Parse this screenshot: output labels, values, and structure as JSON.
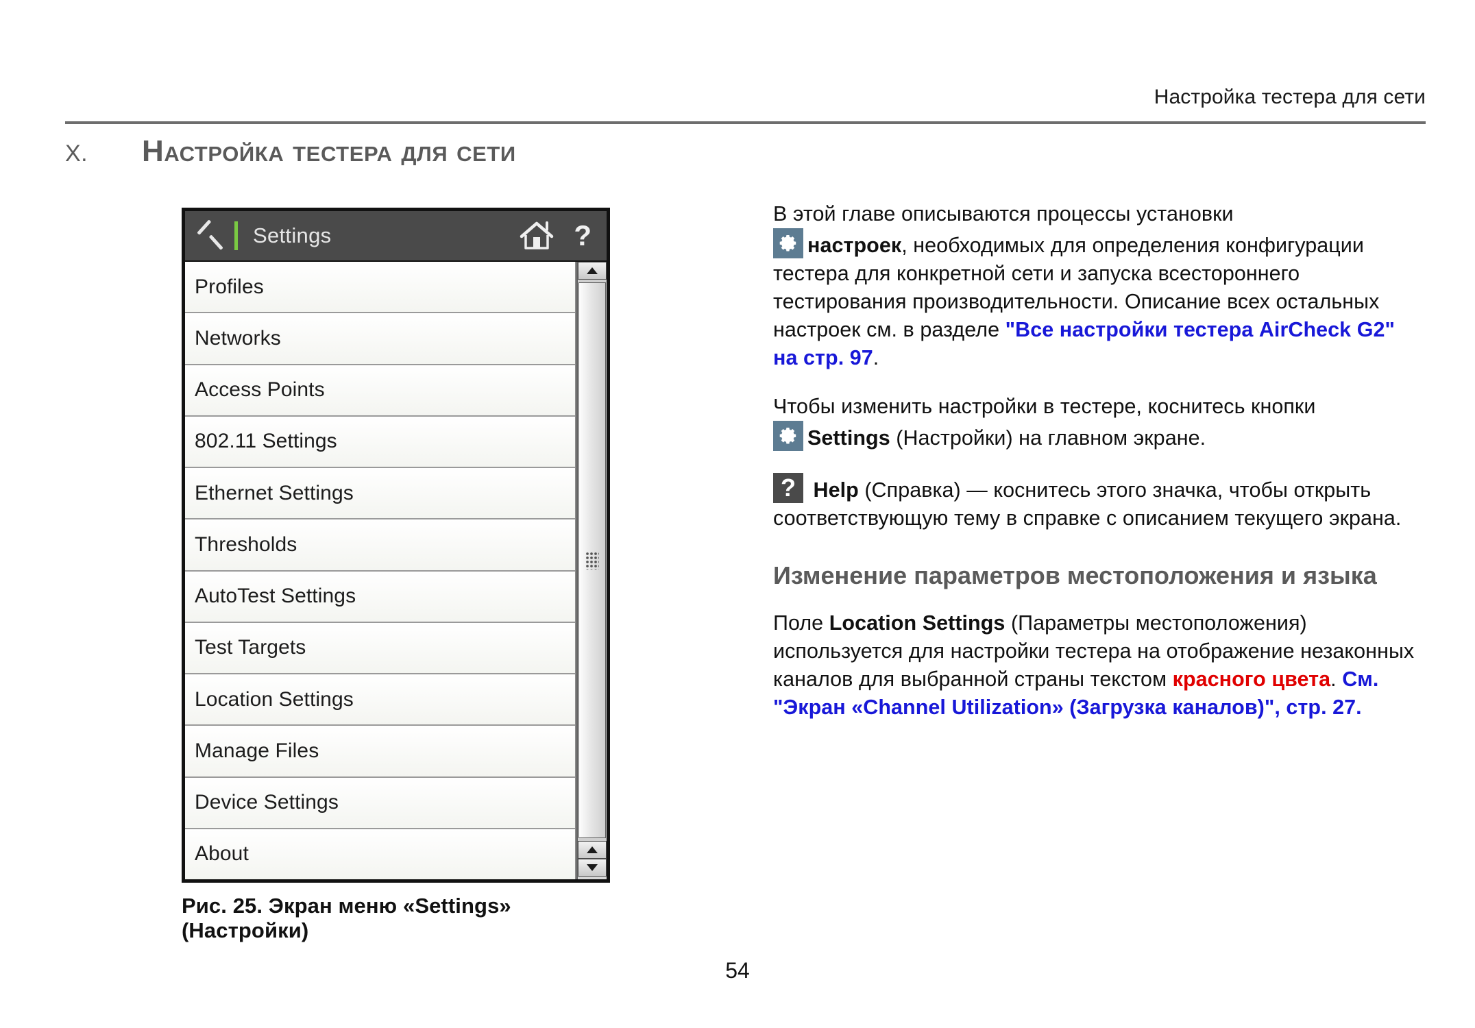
{
  "page": {
    "running_header": "Настройка тестера для сети",
    "number": "54"
  },
  "chapter": {
    "number": "X.",
    "title": "Настройка тестера для сети"
  },
  "figure": {
    "caption": "Рис. 25. Экран меню «Settings» (Настройки)",
    "device": {
      "toolbar": {
        "back_icon": "back-chevron-icon",
        "title": "Settings",
        "home_icon": "home-icon",
        "help_icon": "help-question-icon",
        "accent_color": "#7ac943",
        "background_color": "#4a4a4a"
      },
      "menu_items": [
        "Profiles",
        "Networks",
        "Access Points",
        "802.11 Settings",
        "Ethernet Settings",
        "Thresholds",
        "AutoTest Settings",
        "Test Targets",
        "Location Settings",
        "Manage Files",
        "Device Settings",
        "About"
      ],
      "scrollbar": {
        "up_arrow": "scroll-up-arrow-icon",
        "down_arrow": "scroll-down-arrow-icon",
        "grip": "scrollbar-grip-icon"
      }
    }
  },
  "body": {
    "p1": {
      "lead": "В этой главе описываются процессы установки",
      "icon": "gear-icon",
      "bold1": "настроек",
      "mid": ", необходимых для определения конфигурации тестера для конкретной сети и запуска всестороннего тестирования производительности. Описание всех остальных настроек см. в разделе ",
      "link": "\"Все настройки тестера AirCheck G2\" на стр. 97",
      "tail": "."
    },
    "p2": {
      "lead": "Чтобы изменить настройки в тестере, коснитесь кнопки",
      "icon": "gear-icon",
      "bold1": "Settings",
      "tail": " (Настройки) на главном экране."
    },
    "p3": {
      "icon": "help-question-icon",
      "bold1": "Help",
      "tail": " (Справка) — коснитесь этого значка, чтобы открыть соответствующую тему в справке с описанием текущего экрана."
    },
    "section_heading": "Изменение параметров местоположения и языка",
    "p4": {
      "lead": "Поле ",
      "bold1": "Location Settings",
      "mid": " (Параметры местоположения) используется для настройки тестера на отображение незаконных каналов для выбранной страны текстом ",
      "red": "красного цвета",
      "mid2": ". ",
      "link": "См. \"Экран «Channel Utilization» (Загрузка каналов)\", стр. 27."
    }
  },
  "colors": {
    "link": "#1818d8",
    "red": "#e00000",
    "heading_gray": "#5a5a5a",
    "gear_badge": "#5d7c92",
    "help_badge": "#4a4a4a",
    "device_toolbar": "#4a4a4a",
    "device_accent": "#7ac943"
  }
}
